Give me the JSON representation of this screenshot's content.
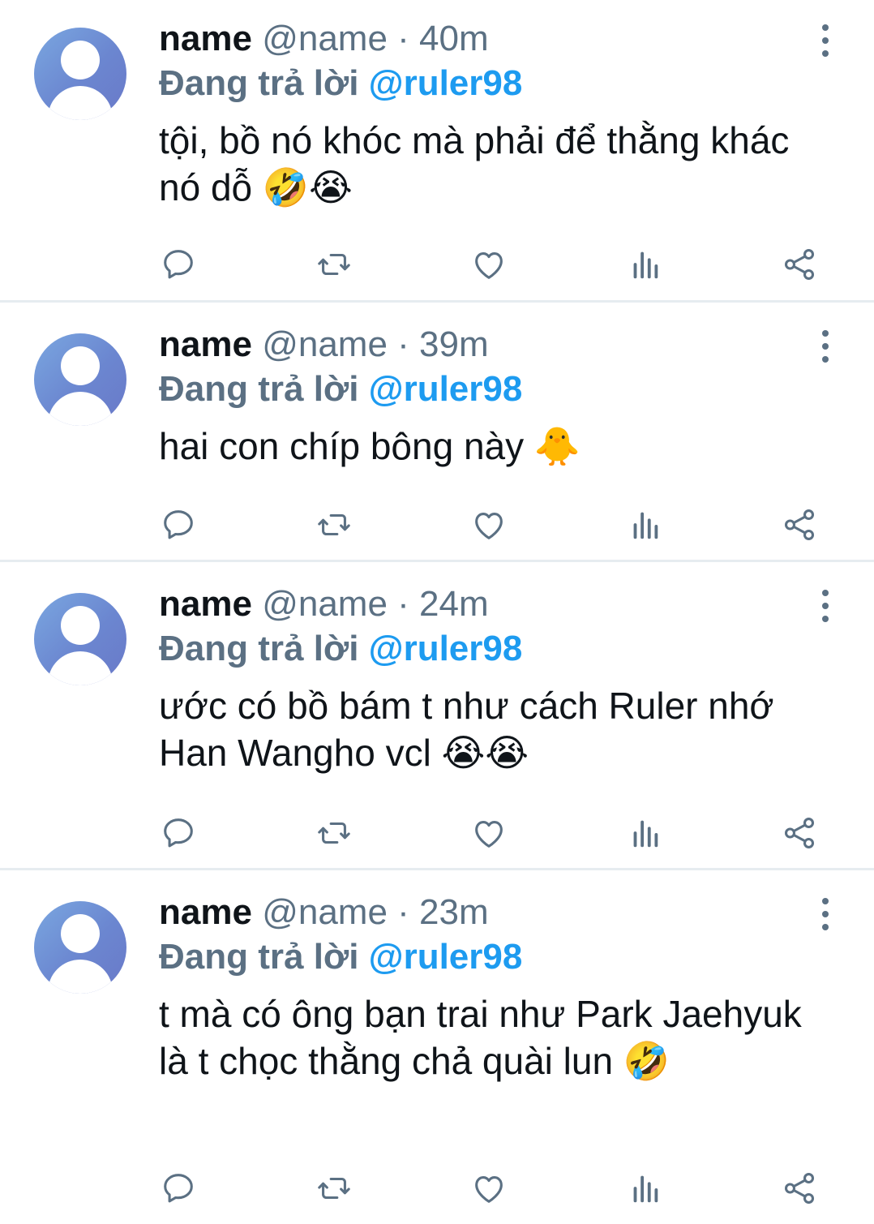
{
  "tweets": [
    {
      "display_name": "name",
      "handle": "@name",
      "separator": "·",
      "time": "40m",
      "reply_prefix": "Đang trả lời",
      "reply_to": "@ruler98",
      "text": "tội, bồ nó khóc mà phải để thằng khác nó dỗ 🤣😭"
    },
    {
      "display_name": "name",
      "handle": "@name",
      "separator": "·",
      "time": "39m",
      "reply_prefix": "Đang trả lời",
      "reply_to": "@ruler98",
      "text": "hai con chíp bông này 🐥"
    },
    {
      "display_name": "name",
      "handle": "@name",
      "separator": "·",
      "time": "24m",
      "reply_prefix": "Đang trả lời",
      "reply_to": "@ruler98",
      "text": "ước có bồ bám t như cách Ruler nhớ Han Wangho vcl 😭😭"
    },
    {
      "display_name": "name",
      "handle": "@name",
      "separator": "·",
      "time": "23m",
      "reply_prefix": "Đang trả lời",
      "reply_to": "@ruler98",
      "text": "t mà có ông bạn trai như Park Jaehyuk là t chọc thằng chả quài lun 🤣"
    }
  ],
  "icons": [
    "more-icon",
    "reply-icon",
    "retweet-icon",
    "like-icon",
    "analytics-icon",
    "share-icon"
  ],
  "colors": {
    "text": "#0f1419",
    "secondary": "#5b7083",
    "mention": "#1d9bf0",
    "divider": "#e6ecf0"
  }
}
